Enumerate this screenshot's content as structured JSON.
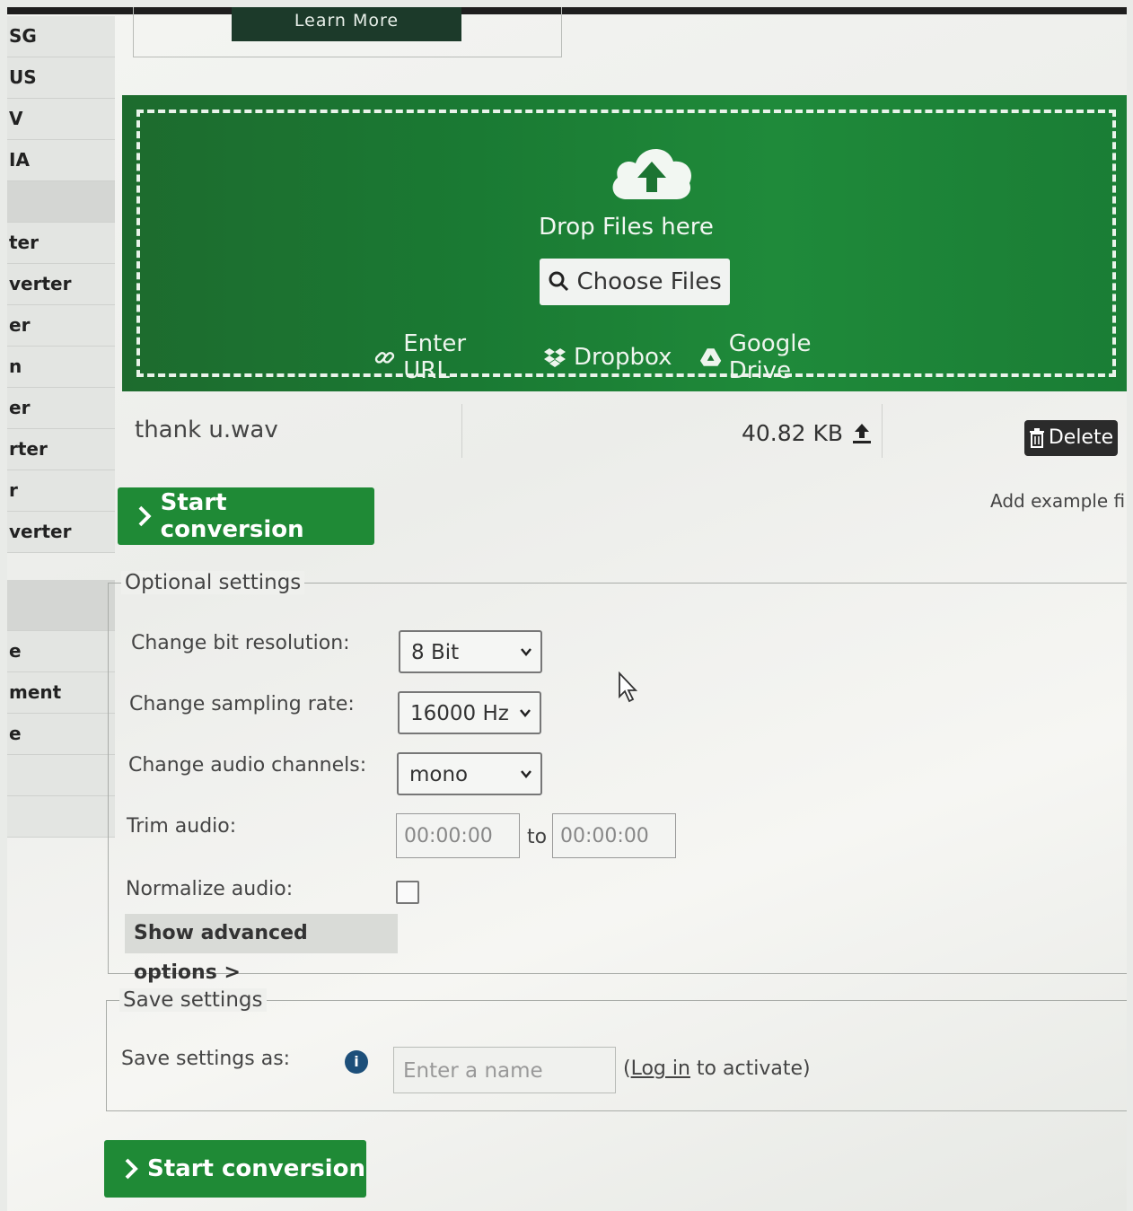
{
  "sidebar": {
    "items": [
      "SG",
      "US",
      "V",
      "IA",
      "",
      "ter",
      "verter",
      "er",
      "n",
      "er",
      "rter",
      "r",
      "verter"
    ],
    "items_lower": [
      "",
      "e",
      "ment",
      "e",
      "",
      ""
    ]
  },
  "learn_more": "Learn More",
  "dropzone": {
    "drop_text": "Drop Files here",
    "choose_files": "Choose Files",
    "enter_url": "Enter URL",
    "dropbox": "Dropbox",
    "google_drive": "Google Drive"
  },
  "file": {
    "name": "thank u.wav",
    "size": "40.82 KB",
    "delete_label": "Delete"
  },
  "start_conversion": "Start conversion",
  "add_example": "Add example file",
  "optional_settings": {
    "legend": "Optional settings",
    "bit_resolution_label": "Change bit resolution:",
    "bit_resolution_value": "8 Bit",
    "sampling_rate_label": "Change sampling rate:",
    "sampling_rate_value": "16000 Hz",
    "audio_channels_label": "Change audio channels:",
    "audio_channels_value": "mono",
    "trim_label": "Trim audio:",
    "trim_from_placeholder": "00:00:00",
    "trim_to_word": "to",
    "trim_to_placeholder": "00:00:00",
    "normalize_label": "Normalize audio:",
    "advanced_button": "Show advanced options >"
  },
  "save_settings": {
    "legend": "Save settings",
    "label": "Save settings as:",
    "name_placeholder": "Enter a name",
    "open_paren": "(",
    "login_link": "Log in",
    "login_suffix": " to activate)"
  },
  "colors": {
    "brand_green": "#1f8a36",
    "dropzone_green": "#1a7a33",
    "delete_bg": "#2b2b2b"
  }
}
